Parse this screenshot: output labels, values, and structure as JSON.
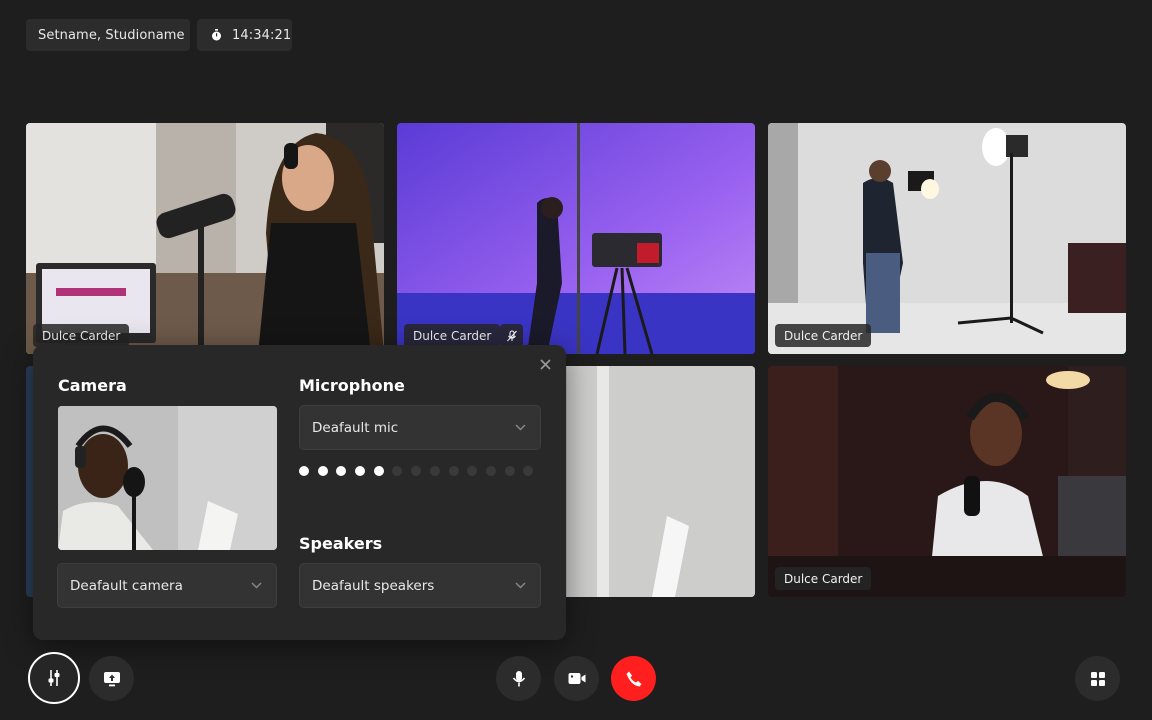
{
  "header": {
    "set_name": "Setname, Studioname",
    "timer": "14:34:21"
  },
  "tiles": [
    {
      "name": "Dulce Carder",
      "muted": false
    },
    {
      "name": "Dulce Carder",
      "muted": true
    },
    {
      "name": "Dulce Carder",
      "muted": false
    },
    {
      "name": "",
      "muted": false
    },
    {
      "name": "",
      "muted": false
    },
    {
      "name": "Dulce Carder",
      "muted": false
    }
  ],
  "settings": {
    "camera_title": "Camera",
    "camera_select": "Deafault camera",
    "microphone_title": "Microphone",
    "microphone_select": "Deafault mic",
    "mic_level_active": 5,
    "mic_level_total": 13,
    "speakers_title": "Speakers",
    "speakers_select": "Deafault speakers"
  },
  "controls": {
    "end_call_color": "#ff1f1f"
  },
  "icons": [
    "stopwatch-icon",
    "mic-off-icon",
    "close-icon",
    "chevron-down-icon",
    "sliders-icon",
    "screen-share-icon",
    "mic-icon",
    "video-icon",
    "phone-hangup-icon",
    "grid-icon"
  ]
}
